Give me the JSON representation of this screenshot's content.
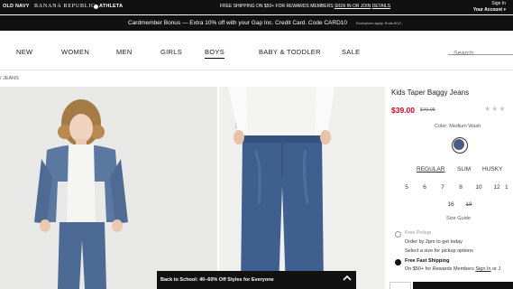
{
  "brands": {
    "old_navy": "OLD NAVY",
    "banana_republic": "BANANA REPUBLIC",
    "athleta": "ATHLETA"
  },
  "top_promo": {
    "text": "FREE SHIPPING ON $50+ FOR REWARDS MEMBERS",
    "signin_link": "SIGN IN OR JOIN",
    "details_link": "DETAILS"
  },
  "account": {
    "sign_in": "Sign In",
    "your_account": "Your Account"
  },
  "cardbar": {
    "text": "Cardmember Bonus — Extra 10% off with your Gap Inc. Credit Card. Code CARD10",
    "fine_print": "Exclusions apply. Ends 8/12."
  },
  "nav": {
    "items": [
      "NEW",
      "WOMEN",
      "MEN",
      "GIRLS",
      "BOYS",
      "BABY & TODDLER",
      "SALE"
    ],
    "active": "BOYS",
    "search_placeholder": "Search"
  },
  "breadcrumb": "/ JEANS",
  "product": {
    "title": "Kids Taper Baggy Jeans",
    "price": "$39.00",
    "original_price": "$49.95",
    "stars": "★★★",
    "color_label": "Color: Medium Wash",
    "swatch_color": "#4a5d80",
    "fits": [
      "REGULAR",
      "SLIM",
      "HUSKY"
    ],
    "active_fit": "REGULAR",
    "sizes_row1": [
      "5",
      "6",
      "7",
      "8",
      "10",
      "12",
      "1"
    ],
    "sizes_row2": [
      "16",
      "18"
    ],
    "size_guide": "Size Guide"
  },
  "fulfillment": {
    "pickup_title": "Free Pickup",
    "pickup_line1": "Order by 2pm to get today",
    "pickup_line2": "Select a size for pickup options",
    "shipping_title": "Free Fast Shipping",
    "shipping_line_prefix": "On $50+ for Rewards Members",
    "shipping_signin": "Sign In",
    "shipping_or": "or J"
  },
  "banner": {
    "text": "Back to School: 40–60% Off Styles for Everyone"
  }
}
